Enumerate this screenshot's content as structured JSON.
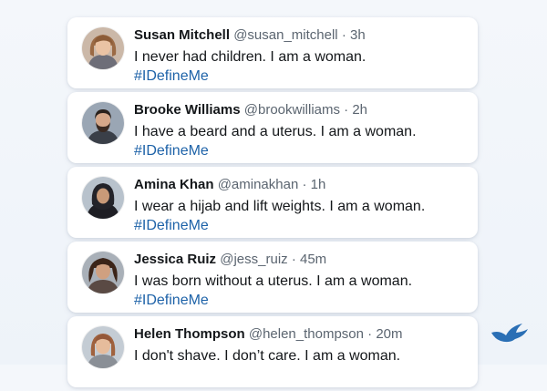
{
  "tweets": [
    {
      "name": "Susan Mitchell",
      "handle": "@susan_mitchell",
      "separator": "·",
      "time": "3h",
      "text": "I never had children. I am a woman.",
      "hashtag": "#IDefineMe"
    },
    {
      "name": "Brooke Williams",
      "handle": "@brookwilliams",
      "separator": "·",
      "time": "2h",
      "text": "I have a beard and a uterus. I am a woman.",
      "hashtag": "#IDefineMe"
    },
    {
      "name": "Amina Khan",
      "handle": "@aminakhan",
      "separator": "·",
      "time": "1h",
      "text": "I wear a hijab and lift weights. I am a woman.",
      "hashtag": "#IDefineMe"
    },
    {
      "name": "Jessica Ruiz",
      "handle": "@jess_ruiz",
      "separator": "·",
      "time": "45m",
      "text": "I was born without a uterus. I am a woman.",
      "hashtag": "#IDefineMe"
    },
    {
      "name": "Helen Thompson",
      "handle": "@helen_thompson",
      "separator": "·",
      "time": "20m",
      "text": "I don't shave. I don’t care. I am a woman.",
      "hashtag": ""
    }
  ],
  "colors": {
    "hashtag": "#1d62a8",
    "brand": "#2a6fb5"
  },
  "icons": {
    "brand": "bird-icon"
  }
}
